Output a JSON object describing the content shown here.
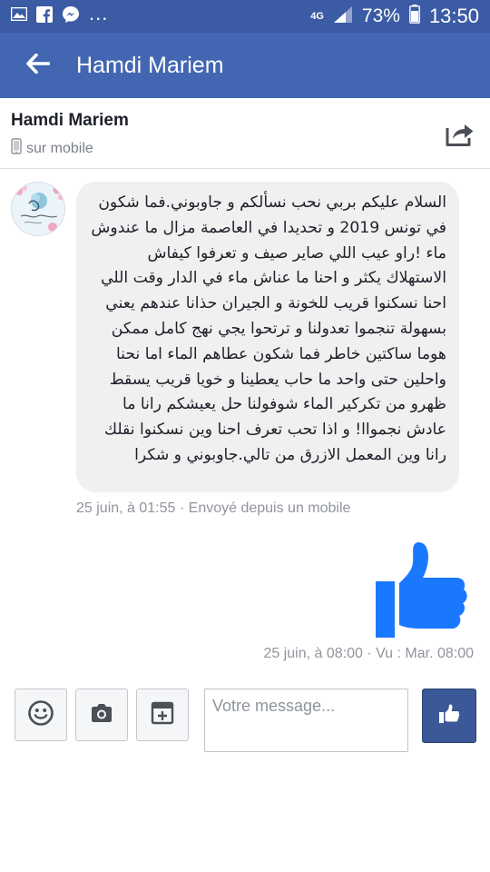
{
  "status_bar": {
    "network": "4G",
    "battery": "73%",
    "time": "13:50",
    "dots": "...",
    "icons": [
      "image-icon",
      "facebook-icon",
      "messenger-icon",
      "signal-icon",
      "battery-icon"
    ]
  },
  "app_bar": {
    "title": "Hamdi Mariem",
    "back_icon": "arrow-left-icon"
  },
  "conversation": {
    "name": "Hamdi Mariem",
    "subtitle": "sur mobile",
    "share_icon": "share-icon"
  },
  "messages": {
    "incoming": {
      "text": "السلام عليكم بربي نحب نسألكم و جاوبوني.فما شكون في تونس  2019 و تحديدا في العاصمة مزال ما عندوش ماء !راو عيب اللي صاير صيف و تعرفوا كيفاش الاستهلاك يكثر و احنا ما عناش ماء في الدار وقت اللي احنا نسكنوا قريب للخونة و الجيران حذانا عندهم يعني بسهولة تنجموا تعدولنا و ترتحوا يجي نهج كامل ممكن هوما ساكتين خاطر فما شكون عطاهم الماء اما نحنا واحلين حتى واحد ما حاب يعطينا و خويا قريب يسقط ظهرو من تكركير الماء شوفولنا حل يعيشكم رانا ما عادش نجمواا! و اذا تحب تعرف احنا وين نسكنوا نقلك رانا وين المعمل الازرق من تالي.جاوبوني و شكرا",
      "meta": "25 juin, à 01:55 · Envoyé depuis un mobile"
    },
    "outgoing": {
      "type": "like",
      "meta": "25 juin, à 08:00 · Vu : Mar. 08:00"
    }
  },
  "composer": {
    "placeholder": "Votre message...",
    "value": "",
    "buttons": [
      "smiley-icon",
      "camera-icon",
      "sticker-icon",
      "like-icon"
    ]
  },
  "colors": {
    "status_bar": "#3b5ba4",
    "app_bar": "#4266b2",
    "like": "#1a78ff",
    "send_button": "#3b5998",
    "bubble": "#f1f0f0"
  }
}
